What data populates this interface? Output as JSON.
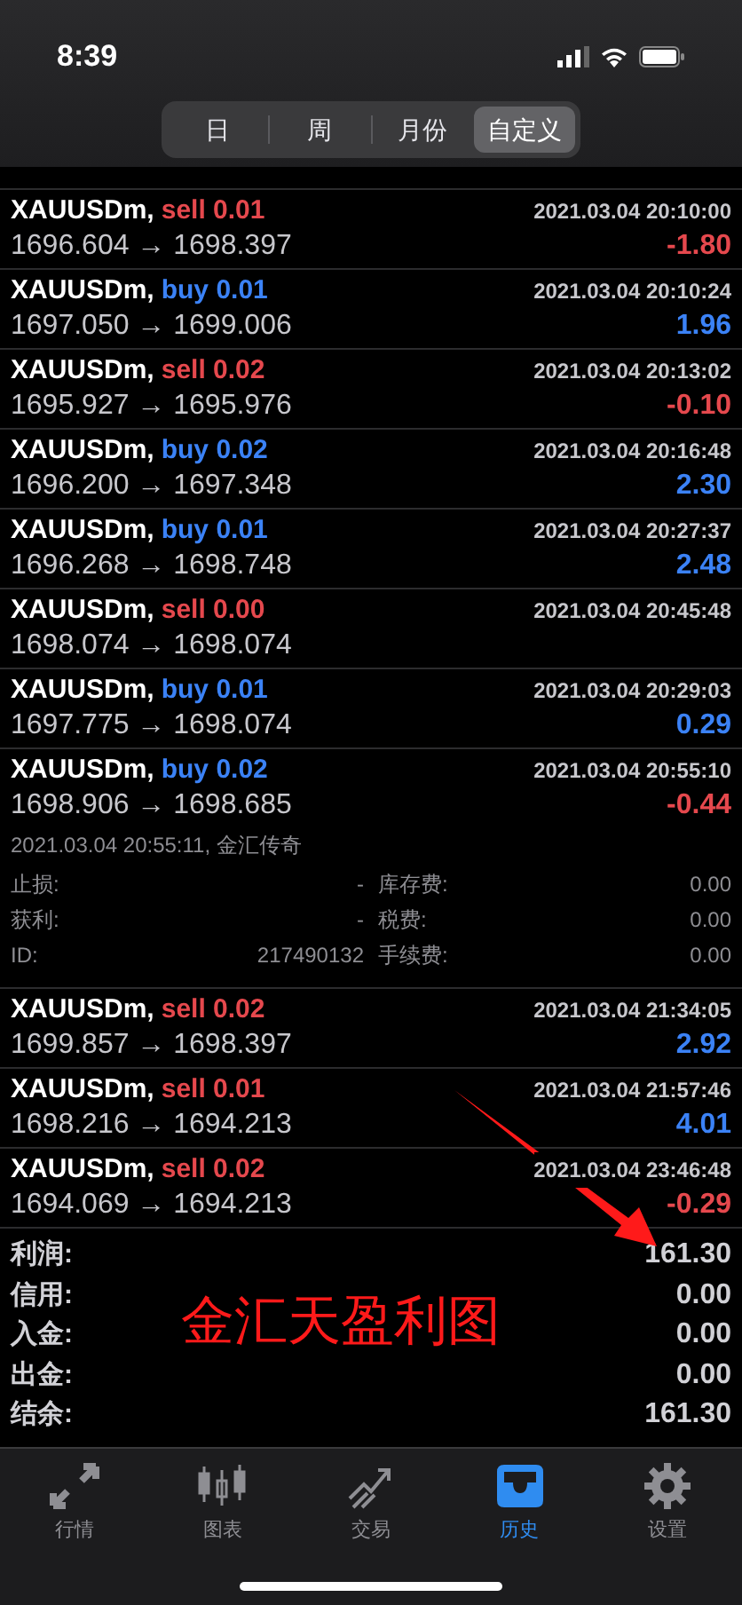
{
  "status_bar": {
    "time": "8:39"
  },
  "segments": [
    {
      "label": "日",
      "selected": false
    },
    {
      "label": "周",
      "selected": false
    },
    {
      "label": "月份",
      "selected": false
    },
    {
      "label": "自定义",
      "selected": true
    }
  ],
  "deals": [
    {
      "symbol": "XAUUSDm,",
      "order": {
        "text": "sell 0.01",
        "kind": "sell"
      },
      "time": "2021.03.04 20:10:00",
      "prices": "1696.604 → 1698.397",
      "profit": {
        "text": "-1.80",
        "kind": "loss"
      }
    },
    {
      "symbol": "XAUUSDm,",
      "order": {
        "text": "buy 0.01",
        "kind": "buy"
      },
      "time": "2021.03.04 20:10:24",
      "prices": "1697.050 → 1699.006",
      "profit": {
        "text": "1.96",
        "kind": "gain"
      }
    },
    {
      "symbol": "XAUUSDm,",
      "order": {
        "text": "sell 0.02",
        "kind": "sell"
      },
      "time": "2021.03.04 20:13:02",
      "prices": "1695.927 → 1695.976",
      "profit": {
        "text": "-0.10",
        "kind": "loss"
      }
    },
    {
      "symbol": "XAUUSDm,",
      "order": {
        "text": "buy 0.02",
        "kind": "buy"
      },
      "time": "2021.03.04 20:16:48",
      "prices": "1696.200 → 1697.348",
      "profit": {
        "text": "2.30",
        "kind": "gain"
      }
    },
    {
      "symbol": "XAUUSDm,",
      "order": {
        "text": "buy 0.01",
        "kind": "buy"
      },
      "time": "2021.03.04 20:27:37",
      "prices": "1696.268 → 1698.748",
      "profit": {
        "text": "2.48",
        "kind": "gain"
      }
    },
    {
      "symbol": "XAUUSDm,",
      "order": {
        "text": "sell 0.00",
        "kind": "sell"
      },
      "time": "2021.03.04 20:45:48",
      "prices": "1698.074 → 1698.074"
    },
    {
      "symbol": "XAUUSDm,",
      "order": {
        "text": "buy 0.01",
        "kind": "buy"
      },
      "time": "2021.03.04 20:29:03",
      "prices": "1697.775 → 1698.074",
      "profit": {
        "text": "0.29",
        "kind": "gain"
      }
    },
    {
      "symbol": "XAUUSDm,",
      "order": {
        "text": "buy 0.02",
        "kind": "buy"
      },
      "time": "2021.03.04 20:55:10",
      "prices": "1698.906 → 1698.685",
      "profit": {
        "text": "-0.44",
        "kind": "loss"
      },
      "details": {
        "header": "2021.03.04 20:55:11, 金汇传奇",
        "rows": [
          {
            "label": "止损:",
            "value": "-",
            "label_2": "库存费:",
            "value_2": "0.00"
          },
          {
            "label": "获利:",
            "value": "-",
            "label_2": "税费:",
            "value_2": "0.00"
          },
          {
            "label": "ID:",
            "value": "217490132",
            "label_2": "手续费:",
            "value_2": "0.00"
          }
        ]
      }
    },
    {
      "symbol": "XAUUSDm,",
      "order": {
        "text": "sell 0.02",
        "kind": "sell"
      },
      "time": "2021.03.04 21:34:05",
      "prices": "1699.857 → 1698.397",
      "profit": {
        "text": "2.92",
        "kind": "gain"
      }
    },
    {
      "symbol": "XAUUSDm,",
      "order": {
        "text": "sell 0.01",
        "kind": "sell"
      },
      "time": "2021.03.04 21:57:46",
      "prices": "1698.216 → 1694.213",
      "profit": {
        "text": "4.01",
        "kind": "gain"
      }
    },
    {
      "symbol": "XAUUSDm,",
      "order": {
        "text": "sell 0.02",
        "kind": "sell"
      },
      "time": "2021.03.04 23:46:48",
      "prices": "1694.069 → 1694.213",
      "profit": {
        "text": "-0.29",
        "kind": "loss"
      }
    }
  ],
  "summary": [
    {
      "label": "利润:",
      "value": "161.30"
    },
    {
      "label": "信用:",
      "value": "0.00"
    },
    {
      "label": "入金:",
      "value": "0.00"
    },
    {
      "label": "出金:",
      "value": "0.00"
    },
    {
      "label": "结余:",
      "value": "161.30"
    }
  ],
  "annotation": {
    "text": "金汇天盈利图"
  },
  "tab_bar": [
    {
      "kind": "quotes",
      "label": "行情",
      "selected": false
    },
    {
      "kind": "chart",
      "label": "图表",
      "selected": false
    },
    {
      "kind": "trade",
      "label": "交易",
      "selected": false
    },
    {
      "kind": "history",
      "label": "历史",
      "selected": true
    },
    {
      "kind": "settings",
      "label": "设置",
      "selected": false
    }
  ]
}
